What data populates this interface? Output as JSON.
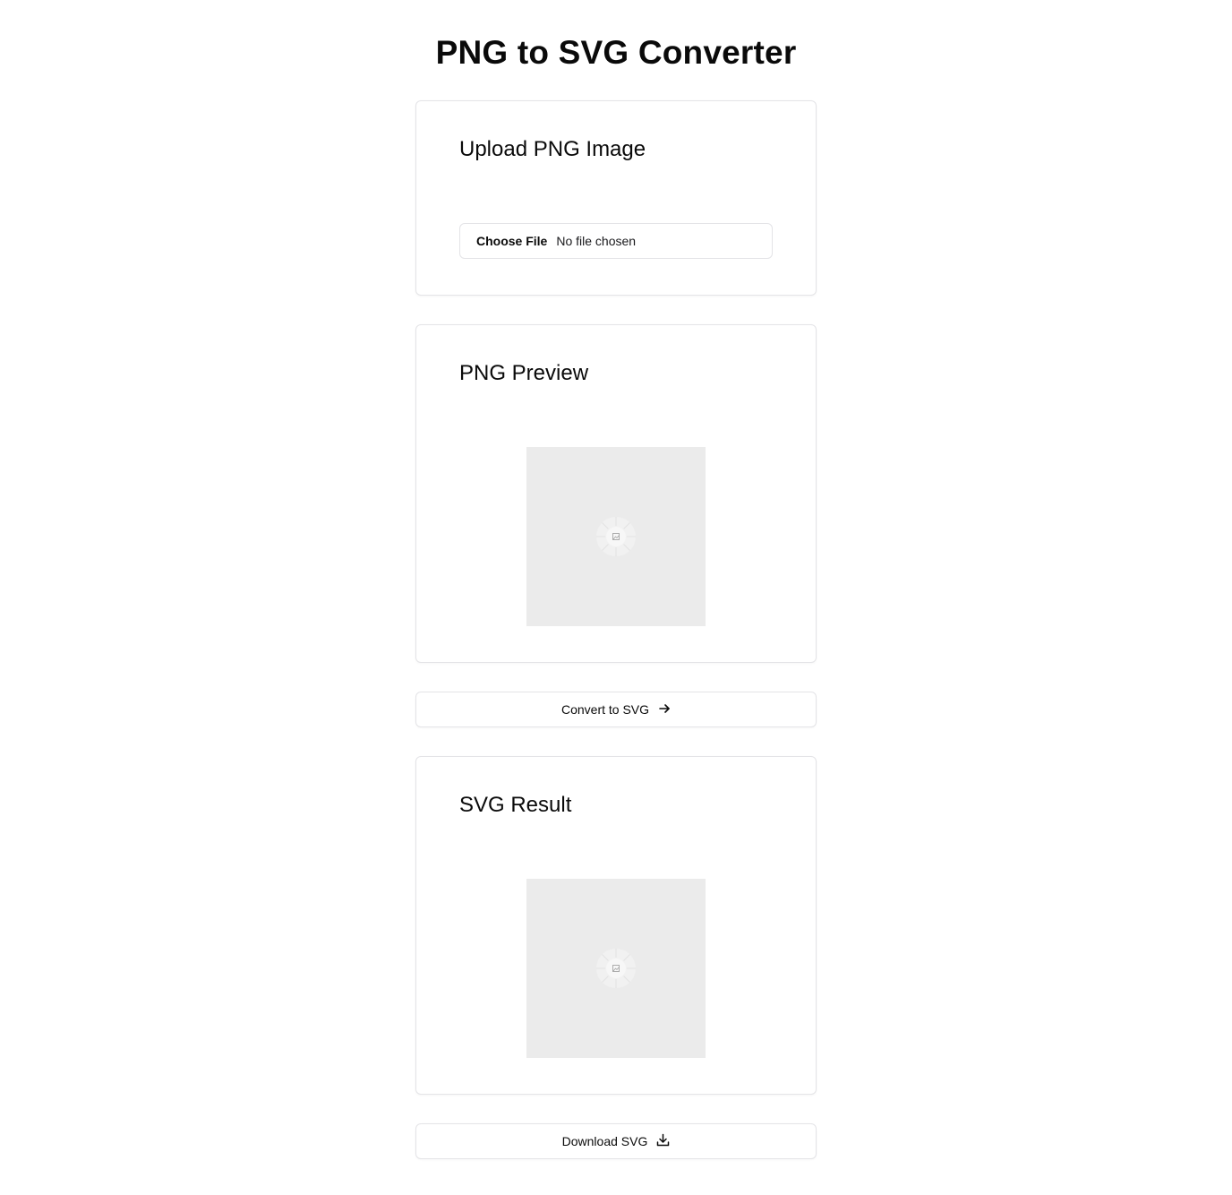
{
  "page": {
    "title": "PNG to SVG Converter"
  },
  "upload": {
    "title": "Upload PNG Image",
    "choose_file_label": "Choose File",
    "file_status": "No file chosen"
  },
  "preview": {
    "title": "PNG Preview",
    "image_icon": "image-placeholder-icon"
  },
  "convert": {
    "label": "Convert to SVG",
    "icon": "arrow-right-icon"
  },
  "result": {
    "title": "SVG Result",
    "image_icon": "image-placeholder-icon"
  },
  "download": {
    "label": "Download SVG",
    "icon": "download-icon"
  },
  "colors": {
    "border": "#e4e4e7",
    "placeholder_bg": "#ebebeb",
    "text": "#0a0a0a"
  }
}
